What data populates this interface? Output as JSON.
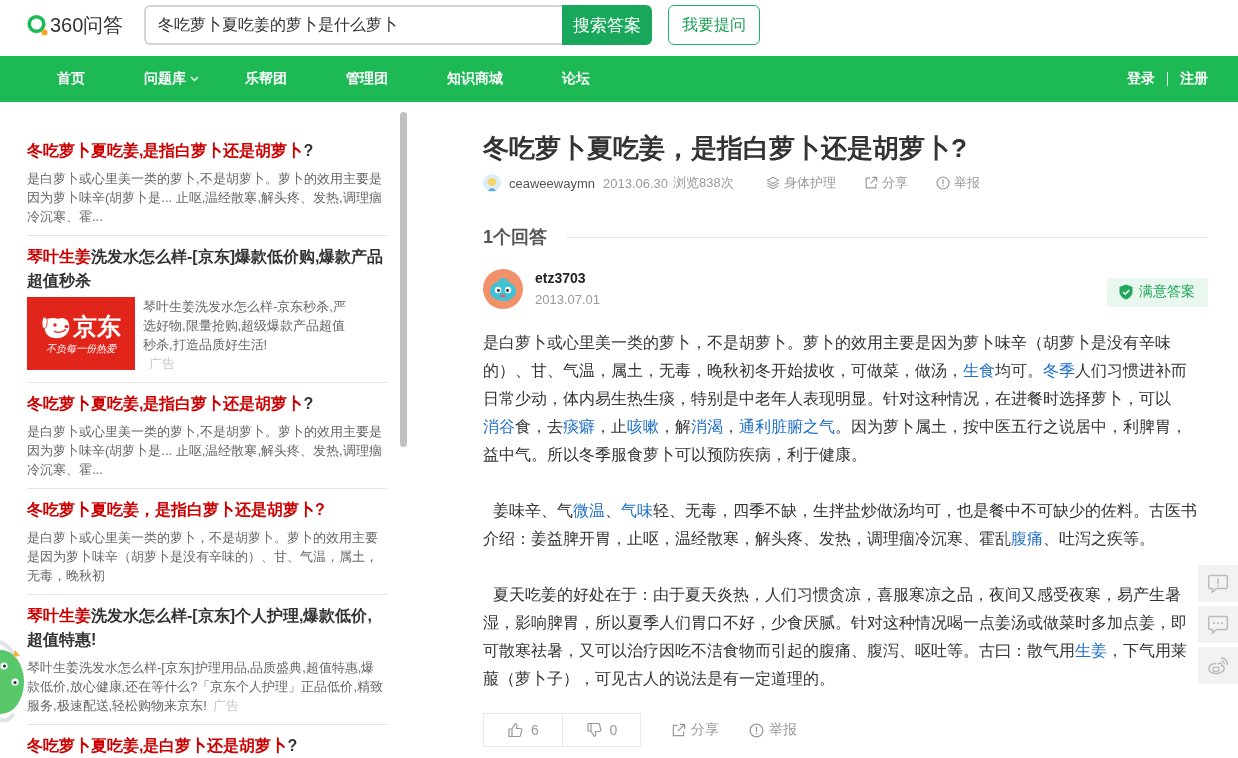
{
  "header": {
    "logo_text": "360问答",
    "search": {
      "value": "冬吃萝卜夏吃姜的萝卜是什么萝卜",
      "button": "搜索答案"
    },
    "ask_button": "我要提问"
  },
  "nav": {
    "items": [
      {
        "label": "首页",
        "dropdown": false
      },
      {
        "label": "问题库",
        "dropdown": true
      },
      {
        "label": "乐帮团",
        "dropdown": false
      },
      {
        "label": "管理团",
        "dropdown": false
      },
      {
        "label": "知识商城",
        "dropdown": false
      },
      {
        "label": "论坛",
        "dropdown": false
      }
    ],
    "account_links": [
      "登录",
      "注册"
    ]
  },
  "sidebar": {
    "items": [
      {
        "kind": "result",
        "title_parts": [
          {
            "text": "冬吃萝卜夏吃姜,是指白萝卜还是胡萝卜",
            "highlight": true
          },
          {
            "text": "?",
            "highlight": false
          }
        ],
        "snippet": "是白萝卜或心里美一类的萝卜,不是胡萝卜。萝卜的效用主要是因为萝卜味辛(胡萝卜是... 止呕,温经散寒,解头疼、发热,调理痼冷沉寒、霍..."
      },
      {
        "kind": "image_ad",
        "title_parts": [
          {
            "text": "琴叶生姜",
            "highlight": true
          },
          {
            "text": "洗发水怎么样-[京东]爆款低价购,爆款产品超值秒杀",
            "highlight": false
          }
        ],
        "image": {
          "logo_text": "京东",
          "slogan": "不负每一份热爱"
        },
        "snippet": "琴叶生姜洗发水怎么样-京东秒杀,严选好物,限量抢购,超级爆款产品超值秒杀,打造品质好生活!",
        "ad_label": "广告"
      },
      {
        "kind": "result",
        "title_parts": [
          {
            "text": "冬吃萝卜夏吃姜,是指白萝卜还是胡萝卜",
            "highlight": true
          },
          {
            "text": "?",
            "highlight": false
          }
        ],
        "snippet": "是白萝卜或心里美一类的萝卜,不是胡萝卜。萝卜的效用主要是因为萝卜味辛(胡萝卜是... 止呕,温经散寒,解头疼、发热,调理痼冷沉寒、霍..."
      },
      {
        "kind": "result",
        "title_parts": [
          {
            "text": "冬吃萝卜夏吃姜，是指白萝卜还是胡萝卜?",
            "highlight": true
          }
        ],
        "snippet": "是白萝卜或心里美一类的萝卜，不是胡萝卜。萝卜的效用主要是因为萝卜味辛（胡萝卜是没有辛味的）、甘、气温，属土，无毒，晚秋初"
      },
      {
        "kind": "text_ad",
        "title_parts": [
          {
            "text": "琴叶生姜",
            "highlight": true
          },
          {
            "text": "洗发水怎么样-[京东]个人护理,爆款低价,超值特惠!",
            "highlight": false
          }
        ],
        "snippet": "琴叶生姜洗发水怎么样-[京东]护理用品,品质盛典,超值特惠,爆款低价,放心健康,还在等什么?「京东个人护理」正品低价,精致服务,极速配送,轻松购物来京东!",
        "ad_label": "广告"
      },
      {
        "kind": "result",
        "title_parts": [
          {
            "text": "冬吃萝卜夏吃姜,是白萝卜还是胡萝卜",
            "highlight": true
          },
          {
            "text": "?",
            "highlight": false
          }
        ]
      }
    ]
  },
  "question": {
    "title": "冬吃萝卜夏吃姜，是指白萝卜还是胡萝卜?",
    "author": "ceaweewaymn",
    "date": "2013.06.30",
    "views": "浏览838次",
    "category": "身体护理",
    "share": "分享",
    "report": "举报"
  },
  "answers": {
    "heading": "1个回答",
    "items": [
      {
        "user": "etz3703",
        "date": "2013.07.01",
        "best": true,
        "badge": "满意答案",
        "paragraphs": [
          {
            "indented": false,
            "segments": [
              {
                "text": "是白萝卜或心里美一类的萝卜，不是胡萝卜。萝卜的效用主要是因为萝卜味辛（胡萝卜是没有辛味的）、甘、气温，属土，无毒，晚秋初冬开始拔收，可做菜，做汤，",
                "link": false
              },
              {
                "text": "生食",
                "link": true
              },
              {
                "text": "均可。",
                "link": false
              },
              {
                "text": "冬季",
                "link": true
              },
              {
                "text": "人们习惯进补而日常少动，体内易生热生痰，特别是中老年人表现明显。针对这种情况，在进餐时选择萝卜，可以",
                "link": false
              },
              {
                "text": "消谷",
                "link": true
              },
              {
                "text": "食，去",
                "link": false
              },
              {
                "text": "痰癖",
                "link": true
              },
              {
                "text": "，止",
                "link": false
              },
              {
                "text": "咳嗽",
                "link": true
              },
              {
                "text": "，解",
                "link": false
              },
              {
                "text": "消渴",
                "link": true
              },
              {
                "text": "，",
                "link": false
              },
              {
                "text": "通利脏腑之气",
                "link": true
              },
              {
                "text": "。因为萝卜属土，按中医五行之说居中，利脾胃，益中气。所以冬季服食萝卜可以预防疾病，利于健康。",
                "link": false
              }
            ]
          },
          {
            "indented": true,
            "segments": [
              {
                "text": "姜味辛、气",
                "link": false
              },
              {
                "text": "微温",
                "link": true
              },
              {
                "text": "、",
                "link": false
              },
              {
                "text": "气味",
                "link": true
              },
              {
                "text": "轻、无毒，四季不缺，生拌盐炒做汤均可，也是餐中不可缺少的佐料。古医书介绍：姜益脾开胃，止呕，温经散寒，解头疼、发热，调理痼冷沉寒、霍乱",
                "link": false
              },
              {
                "text": "腹痛",
                "link": true
              },
              {
                "text": "、吐泻之疾等。",
                "link": false
              }
            ]
          },
          {
            "indented": true,
            "segments": [
              {
                "text": "夏天吃姜的好处在于：由于夏天炎热，人们习惯贪凉，喜服寒凉之品，夜间又感受夜寒，易产生暑湿，影响脾胃，所以夏季人们胃口不好，少食厌腻。针对这种情况喝一点姜汤或做菜时多加点姜，即可散寒祛暑，又可以治疗因吃不洁食物而引起的腹痛、腹泻、呕吐等。古曰：散气用",
                "link": false
              },
              {
                "text": "生姜",
                "link": true
              },
              {
                "text": "，下气用莱菔（萝卜子），可见古人的说法是有一定道理的。",
                "link": false
              }
            ]
          }
        ],
        "likes": "6",
        "dislikes": "0",
        "share": "分享",
        "report": "举报"
      }
    ]
  }
}
